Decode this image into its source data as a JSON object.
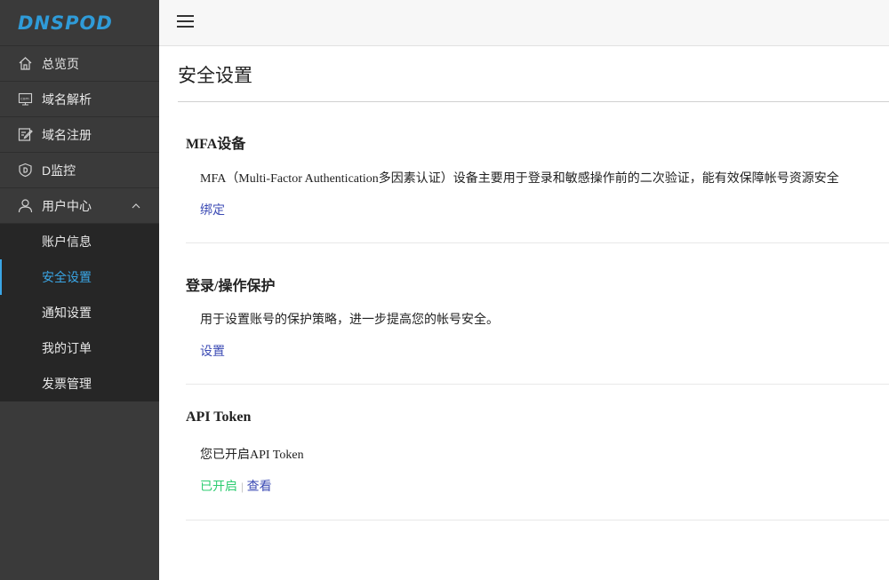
{
  "brand": {
    "logo_text": "DNSPOD",
    "color": "#2f9bd8"
  },
  "sidebar": {
    "items": [
      {
        "label": "总览页",
        "icon": "home-icon"
      },
      {
        "label": "域名解析",
        "icon": "dns-icon"
      },
      {
        "label": "域名注册",
        "icon": "edit-icon"
      },
      {
        "label": "D监控",
        "icon": "shield-icon"
      },
      {
        "label": "用户中心",
        "icon": "user-icon",
        "expanded": true
      }
    ],
    "user_center_subitems": [
      {
        "label": "账户信息"
      },
      {
        "label": "安全设置",
        "active": true
      },
      {
        "label": "通知设置"
      },
      {
        "label": "我的订单"
      },
      {
        "label": "发票管理"
      }
    ],
    "active_color": "#3aa6e6"
  },
  "page": {
    "title": "安全设置"
  },
  "sections": {
    "mfa": {
      "title": "MFA设备",
      "description": "MFA（Multi-Factor Authentication多因素认证）设备主要用于登录和敏感操作前的二次验证，能有效保障帐号资源安全",
      "action": "绑定"
    },
    "login_protection": {
      "title": "登录/操作保护",
      "description": "用于设置账号的保护策略，进一步提高您的帐号安全。",
      "action": "设置"
    },
    "api_token": {
      "title": "API Token",
      "description": "您已开启API Token",
      "status": "已开启",
      "separator": "|",
      "action": "查看",
      "status_color": "#2ecc71"
    }
  },
  "link_color": "#3c4bb4"
}
